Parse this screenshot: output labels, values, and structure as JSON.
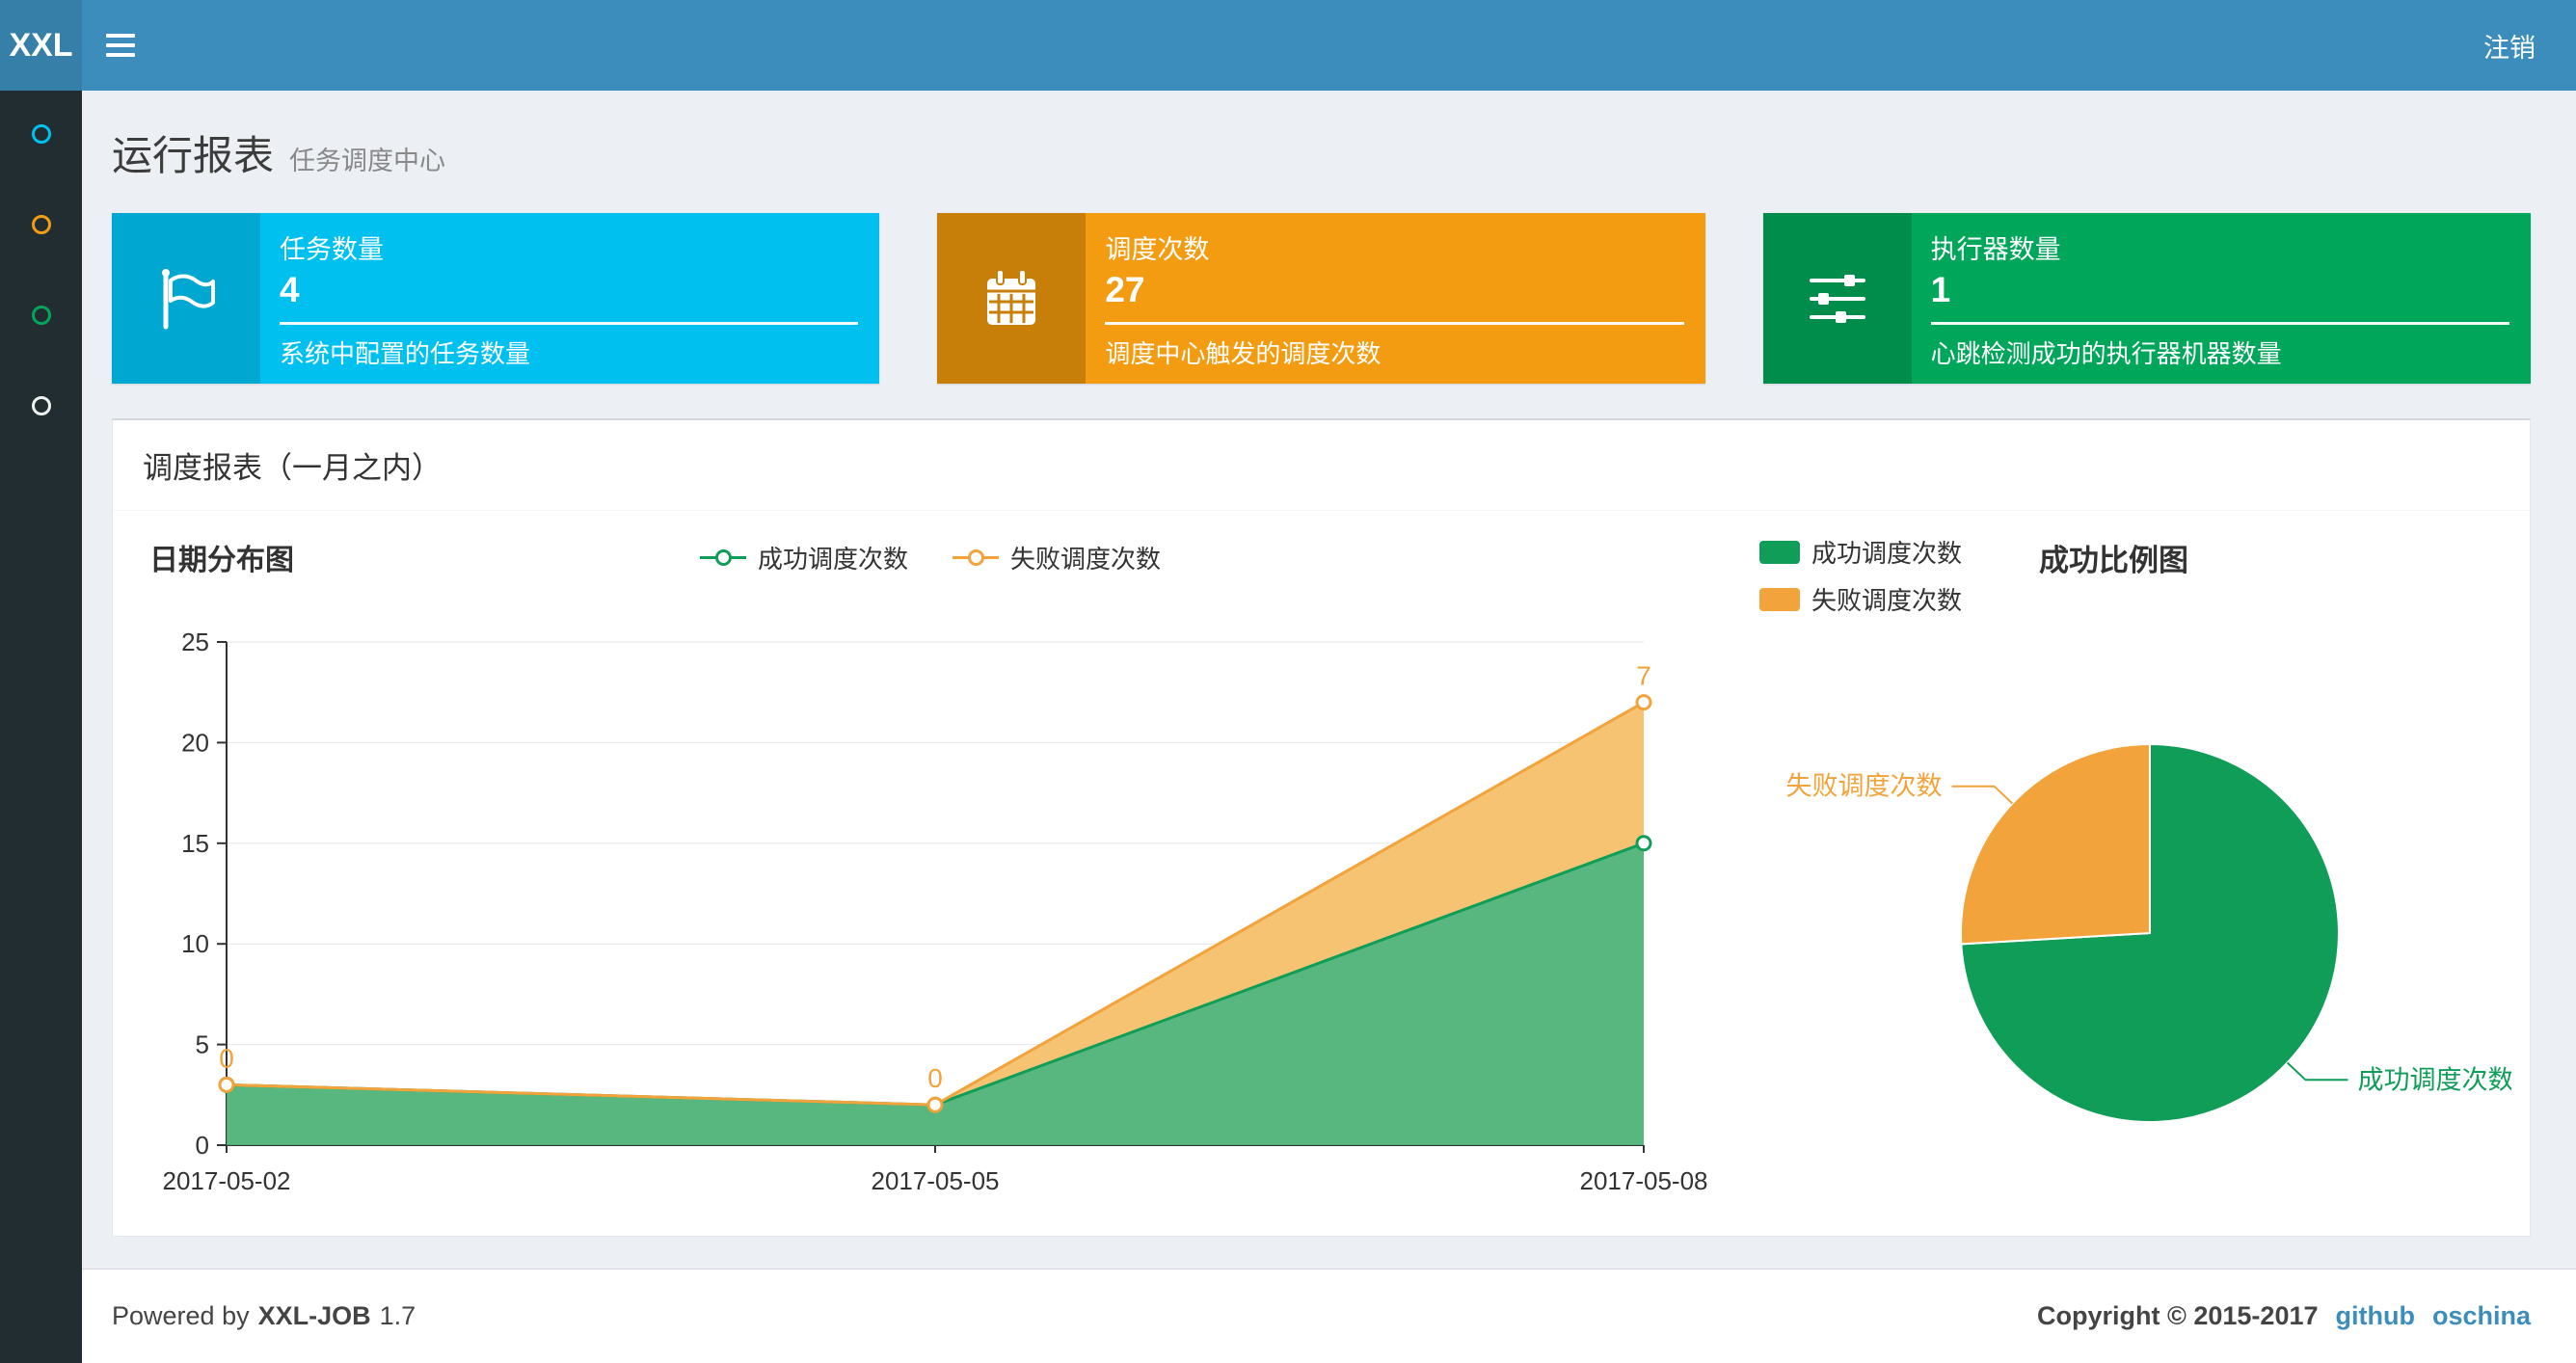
{
  "navbar": {
    "logo": "XXL",
    "logout_label": "注销"
  },
  "sidebar": {
    "items": [
      {
        "icon": "circle-o-icon",
        "color": "#00c0ef"
      },
      {
        "icon": "circle-o-icon",
        "color": "#f39c12"
      },
      {
        "icon": "circle-o-icon",
        "color": "#00a65a"
      },
      {
        "icon": "circle-o-icon",
        "color": "#f0f0f0"
      }
    ]
  },
  "page_header": {
    "title": "运行报表",
    "subtitle": "任务调度中心"
  },
  "info_boxes": [
    {
      "title": "任务数量",
      "value": "4",
      "description": "系统中配置的任务数量",
      "color": "#00c0ef",
      "icon_color": "#00a7d0",
      "icon": "flag-icon"
    },
    {
      "title": "调度次数",
      "value": "27",
      "description": "调度中心触发的调度次数",
      "color": "#f39c12",
      "icon_color": "#c87f0a",
      "icon": "calendar-icon"
    },
    {
      "title": "执行器数量",
      "value": "1",
      "description": "心跳检测成功的执行器机器数量",
      "color": "#00a65a",
      "icon_color": "#008d4c",
      "icon": "sliders-icon"
    }
  ],
  "panel": {
    "title": "调度报表（一月之内）"
  },
  "chart_data": [
    {
      "type": "area",
      "title": "日期分布图",
      "stacked": true,
      "x": [
        "2017-05-02",
        "2017-05-05",
        "2017-05-08"
      ],
      "series": [
        {
          "name": "成功调度次数",
          "values": [
            3,
            2,
            15
          ],
          "color": "#0f9d58",
          "fill": "#4eb378",
          "show_labels": false
        },
        {
          "name": "失败调度次数",
          "values": [
            0,
            0,
            7
          ],
          "color": "#f2a33c",
          "fill": "#f5c06a",
          "show_labels": true
        }
      ],
      "ylim": [
        0,
        25
      ],
      "ytick_step": 5,
      "grid": true,
      "legend_position": "top-center"
    },
    {
      "type": "pie",
      "title": "成功比例图",
      "slices": [
        {
          "name": "成功调度次数",
          "value": 20,
          "color": "#0f9d58",
          "label_side": "right"
        },
        {
          "name": "失败调度次数",
          "value": 7,
          "color": "#f2a33c",
          "label_side": "left"
        }
      ],
      "legend_position": "top-left"
    }
  ],
  "footer": {
    "powered_prefix": "Powered by",
    "product": "XXL-JOB",
    "version": "1.7",
    "copyright": "Copyright © 2015-2017",
    "links": [
      "github",
      "oschina"
    ]
  }
}
